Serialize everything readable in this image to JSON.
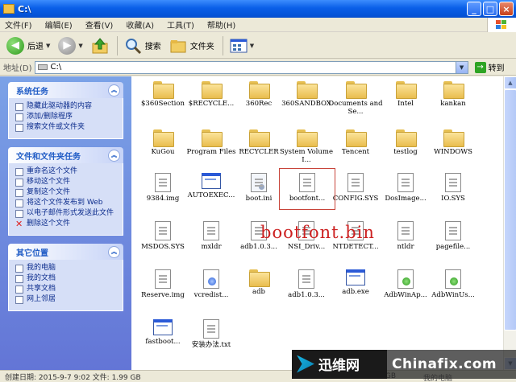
{
  "window": {
    "title": "C:\\"
  },
  "window_buttons": {
    "minimize": "_",
    "maximize": "□",
    "close": "×"
  },
  "menu": [
    "文件(F)",
    "编辑(E)",
    "查看(V)",
    "收藏(A)",
    "工具(T)",
    "帮助(H)"
  ],
  "toolbar": {
    "back": "后退",
    "search": "搜索",
    "folders": "文件夹",
    "back_glyph": "◀",
    "forward_glyph": "▶",
    "dropdown_glyph": "▼"
  },
  "address": {
    "label": "地址(D)",
    "value": "C:\\",
    "go": "转到",
    "go_glyph": "→"
  },
  "tasks": {
    "collapse_glyph": "︽",
    "system": {
      "title": "系统任务",
      "items": [
        "隐藏此驱动器的内容",
        "添加/删除程序",
        "搜索文件或文件夹"
      ]
    },
    "file": {
      "title": "文件和文件夹任务",
      "items": [
        "重命名这个文件",
        "移动这个文件",
        "复制这个文件",
        "将这个文件发布到 Web",
        "以电子邮件形式发送此文件",
        "删除这个文件"
      ]
    },
    "other": {
      "title": "其它位置",
      "items": [
        "我的电脑",
        "我的文档",
        "共享文档",
        "网上邻居"
      ]
    }
  },
  "files": [
    "$360Section",
    "$RECYCLE...",
    "360Rec",
    "360SANDBOX",
    "Documents and Se...",
    "Intel",
    "kankan",
    "KuGou",
    "Program Files",
    "RECYCLER",
    "System Volume I...",
    "Tencent",
    "testlog",
    "WINDOWS",
    "9384.img",
    "AUTOEXEC...",
    "boot.ini",
    "bootfont...",
    "CONFIG.SYS",
    "DosImage...",
    "IO.SYS",
    "MSDOS.SYS",
    "mxldr",
    "adb1.0.3...",
    "NSI_Driv...",
    "NTDETECT...",
    "ntldr",
    "pagefile...",
    "Reserve.img",
    "vcredist...",
    "adb",
    "adb1.0.3...",
    "adb.exe",
    "AdbWinAp...",
    "AdbWinUs...",
    "fastboot...",
    "安装办法.txt"
  ],
  "annotation": "bootfont.bin",
  "status": {
    "text": "创建日期: 2015-9-7 9:02 文件: 1.99 GB",
    "size": "1.99 GB",
    "location": "我的电脑"
  },
  "watermark": {
    "cn": "迅维网",
    "en": "Chinafix.com"
  },
  "scroll": {
    "up": "▲",
    "down": "▼"
  }
}
